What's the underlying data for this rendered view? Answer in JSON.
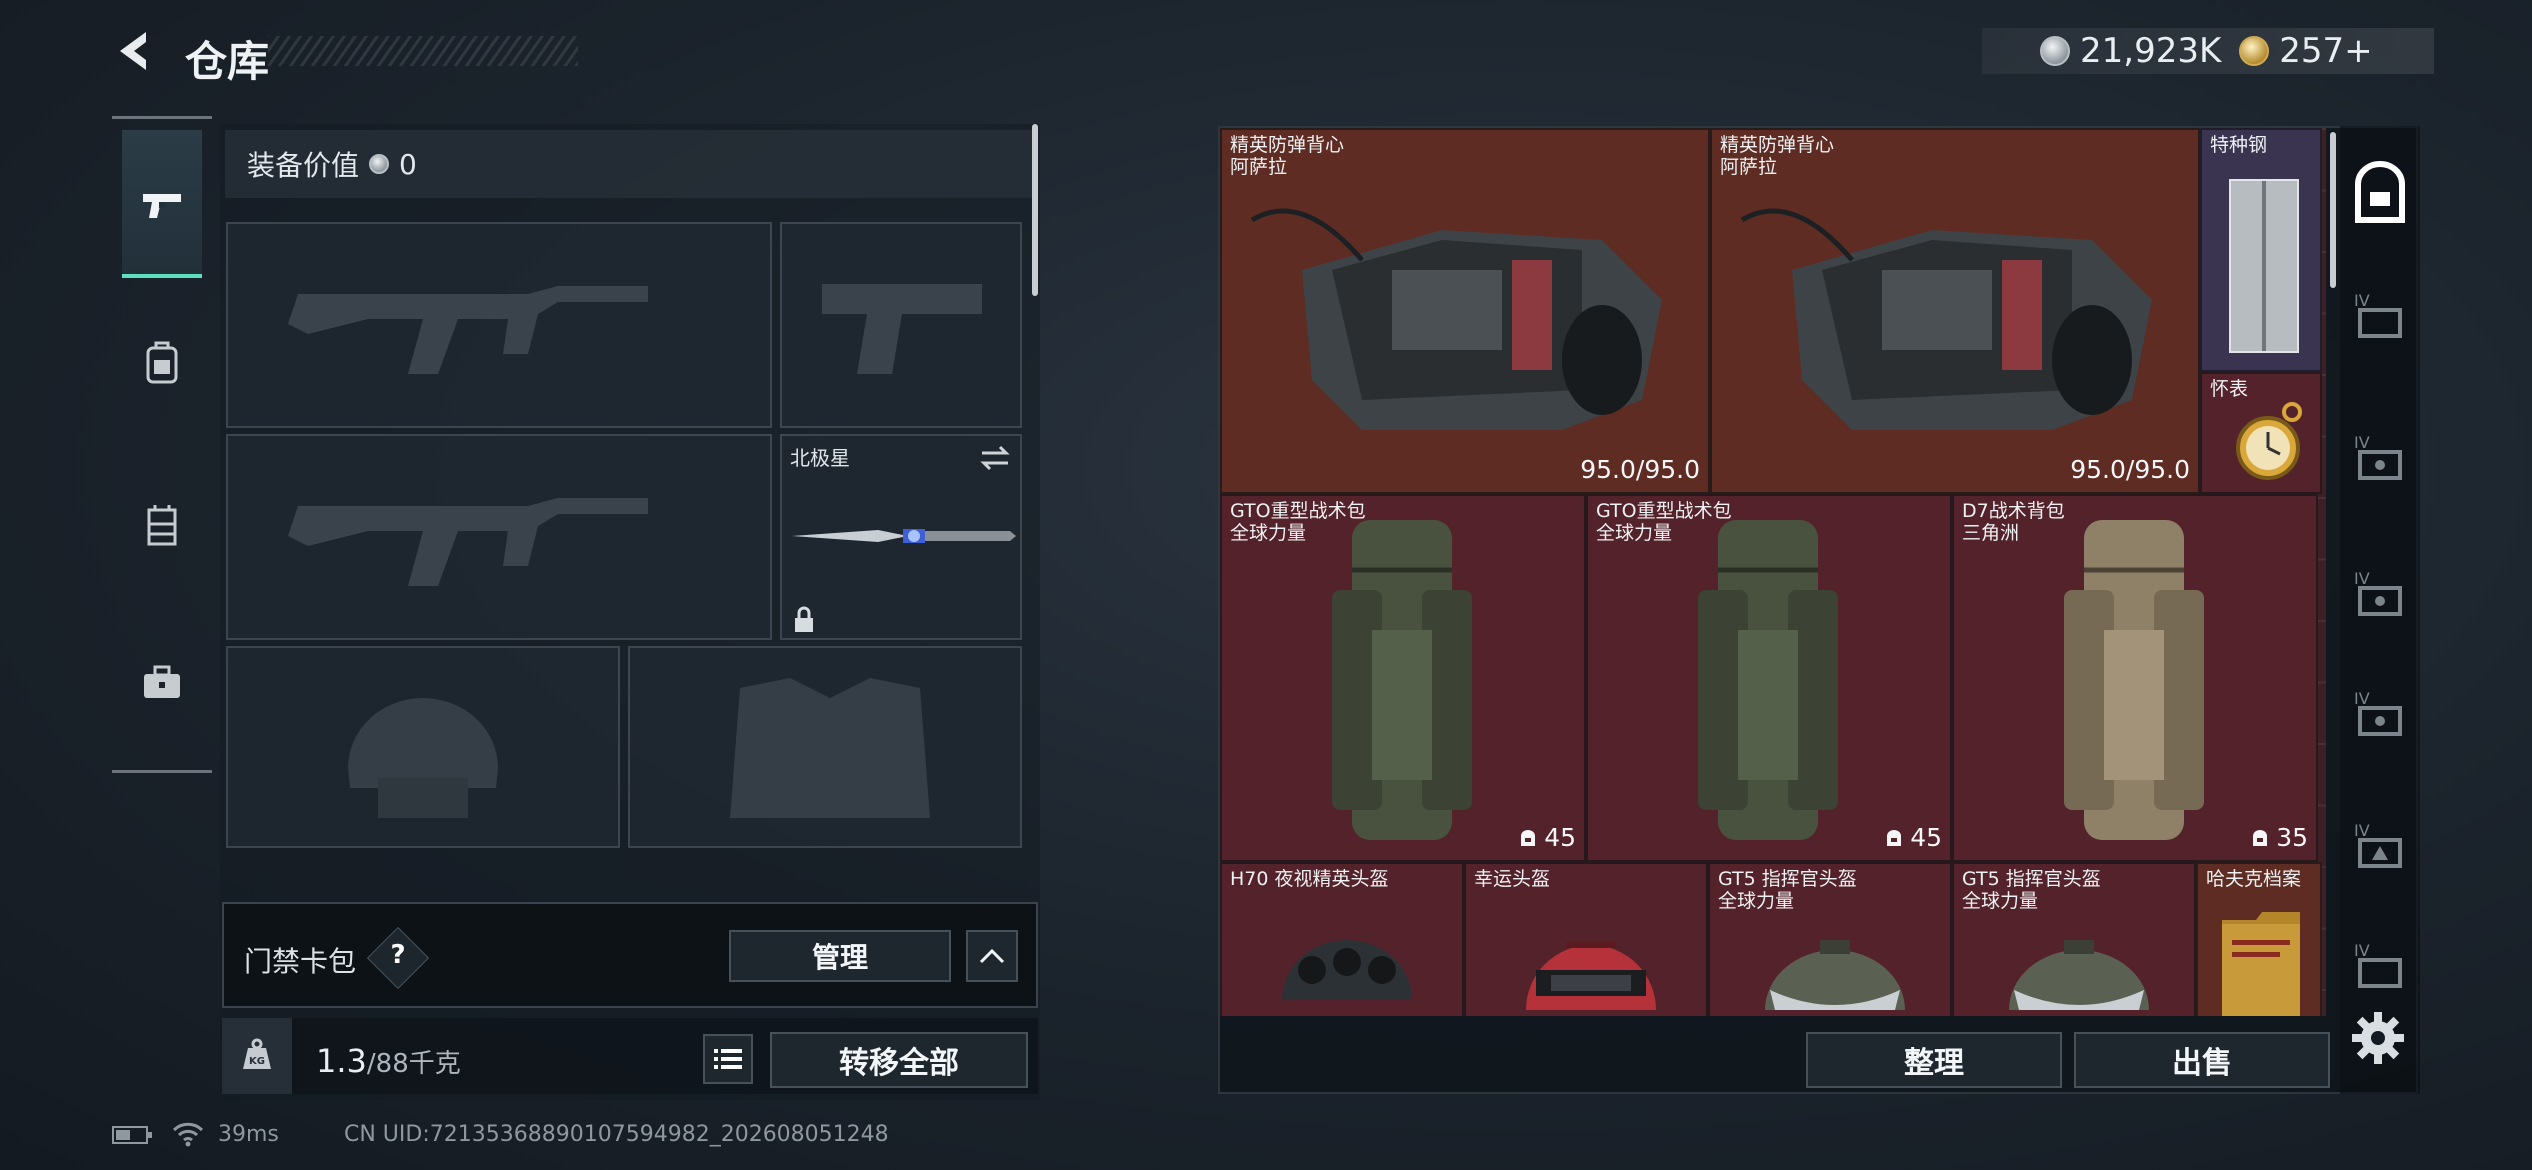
{
  "header": {
    "title": "仓库",
    "currency": [
      {
        "type": "silver-coin",
        "value": "21,923K"
      },
      {
        "type": "gold-coin",
        "value": "257+"
      }
    ]
  },
  "left_nav": [
    {
      "name": "weapon",
      "icon": "pistol-icon",
      "active": true
    },
    {
      "name": "backpack",
      "icon": "backpack-icon",
      "active": false
    },
    {
      "name": "rig",
      "icon": "chest-rig-icon",
      "active": false
    },
    {
      "name": "medkit",
      "icon": "briefcase-icon",
      "active": false
    }
  ],
  "equipment": {
    "value_label": "装备价值",
    "value": "0",
    "melee_slot_label": "北极星"
  },
  "card_pack": {
    "label": "门禁卡包",
    "help": "?",
    "manage_label": "管理"
  },
  "carry": {
    "kg_icon": "KG",
    "current": "1.3",
    "max": "/88千克",
    "transfer_all_label": "转移全部"
  },
  "status_bar": {
    "ping": "39ms",
    "uid": "CN UID:721353688901075949​82_202608051248"
  },
  "storage": {
    "items": [
      {
        "name": "精英防弹背心",
        "sub": "阿萨拉",
        "durability": "95.0/95.0",
        "rarity": "gold"
      },
      {
        "name": "精英防弹背心",
        "sub": "阿萨拉",
        "durability": "95.0/95.0",
        "rarity": "gold"
      },
      {
        "name": "特种钢",
        "sub": "",
        "rarity": "purple"
      },
      {
        "name": "怀表",
        "sub": "",
        "rarity": "red"
      },
      {
        "name": "GTO重型战术包",
        "sub": "全球力量",
        "capacity": "45",
        "rarity": "red"
      },
      {
        "name": "GTO重型战术包",
        "sub": "全球力量",
        "capacity": "45",
        "rarity": "red"
      },
      {
        "name": "D7战术背包",
        "sub": "三角洲",
        "capacity": "35",
        "rarity": "red"
      },
      {
        "name": "H70 夜视精英头盔",
        "sub": "",
        "rarity": "red"
      },
      {
        "name": "幸运头盔",
        "sub": "",
        "rarity": "red"
      },
      {
        "name": "GT5 指挥官头盔",
        "sub": "全球力量",
        "rarity": "red"
      },
      {
        "name": "GT5 指挥官头盔",
        "sub": "全球力量",
        "rarity": "red"
      },
      {
        "name": "哈夫克档案",
        "sub": "",
        "rarity": "gold"
      }
    ],
    "sort_label": "整理",
    "sell_label": "出售"
  },
  "side_tabs": [
    "safe-icon",
    "tier4-case-icon",
    "tier4-case-icon",
    "tier4-case-icon",
    "tier4-case-icon",
    "tier4-case-icon",
    "tier4-case-icon"
  ],
  "colors": {
    "accent": "#5ce0bd",
    "gold_rarity": "#5e2c22",
    "red_rarity": "#54222a",
    "purple_rarity": "#3a3450"
  }
}
